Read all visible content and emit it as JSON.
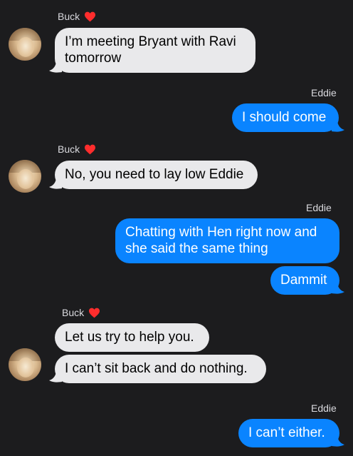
{
  "thread": {
    "incoming_sender": "Buck",
    "outgoing_sender": "Eddie",
    "sender_heart": "❤️",
    "colors": {
      "background": "#1c1c1e",
      "incoming_bubble": "#e9e9eb",
      "outgoing_bubble": "#0a84ff"
    }
  },
  "messages": {
    "m1": {
      "line1": "I’m meeting Bryant with Ravi",
      "line2": "tomorrow"
    },
    "m2": "I should come",
    "m3": "No, you need to lay low Eddie",
    "m4": {
      "line1": "Chatting with Hen right now and",
      "line2": "she said the same thing"
    },
    "m5": "Dammit",
    "m6": "Let us try to help you.",
    "m7": "I can’t sit back and do nothing.",
    "m8": "I can’t either."
  },
  "icons": {
    "avatar": "avatar-photo",
    "heart": "heart-icon"
  }
}
